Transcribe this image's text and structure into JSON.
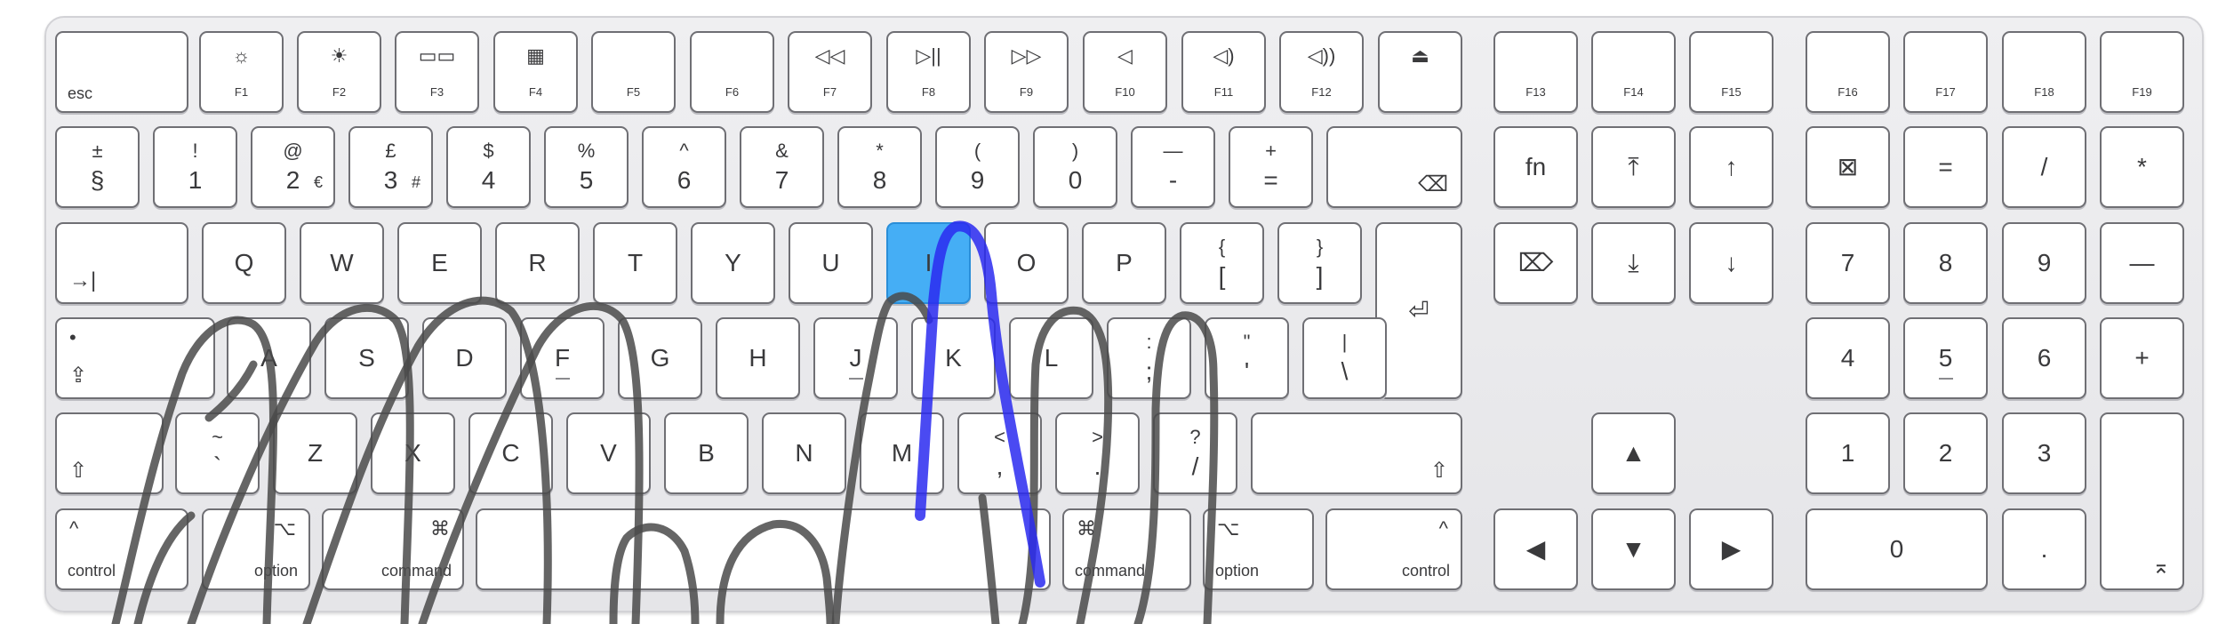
{
  "keyboard": {
    "rows": {
      "fn_row": [
        {
          "id": "esc",
          "bl": "esc"
        },
        {
          "id": "f1",
          "icon": "☼",
          "fn": "F1"
        },
        {
          "id": "f2",
          "icon": "☀",
          "fn": "F2"
        },
        {
          "id": "f3",
          "icon": "▭▭",
          "fn": "F3"
        },
        {
          "id": "f4",
          "icon": "▦",
          "fn": "F4"
        },
        {
          "id": "f5",
          "fn": "F5"
        },
        {
          "id": "f6",
          "fn": "F6"
        },
        {
          "id": "f7",
          "icon": "◁◁",
          "fn": "F7"
        },
        {
          "id": "f8",
          "icon": "▷||",
          "fn": "F8"
        },
        {
          "id": "f9",
          "icon": "▷▷",
          "fn": "F9"
        },
        {
          "id": "f10",
          "icon": "◁",
          "fn": "F10"
        },
        {
          "id": "f11",
          "icon": "◁)",
          "fn": "F11"
        },
        {
          "id": "f12",
          "icon": "◁))",
          "fn": "F12"
        },
        {
          "id": "eject",
          "icon": "⏏"
        },
        {
          "id": "f13",
          "fn": "F13"
        },
        {
          "id": "f14",
          "fn": "F14"
        },
        {
          "id": "f15",
          "fn": "F15"
        },
        {
          "id": "f16",
          "fn": "F16"
        },
        {
          "id": "f17",
          "fn": "F17"
        },
        {
          "id": "f18",
          "fn": "F18"
        },
        {
          "id": "f19",
          "fn": "F19"
        }
      ],
      "number_row": [
        {
          "id": "section",
          "top": "±",
          "bot": "§"
        },
        {
          "id": "1",
          "top": "!",
          "bot": "1"
        },
        {
          "id": "2",
          "top": "@",
          "bot": "2",
          "side": "€"
        },
        {
          "id": "3",
          "top": "£",
          "bot": "3",
          "side": "#"
        },
        {
          "id": "4",
          "top": "$",
          "bot": "4"
        },
        {
          "id": "5",
          "top": "%",
          "bot": "5"
        },
        {
          "id": "6",
          "top": "^",
          "bot": "6"
        },
        {
          "id": "7",
          "top": "&",
          "bot": "7"
        },
        {
          "id": "8",
          "top": "*",
          "bot": "8"
        },
        {
          "id": "9",
          "top": "(",
          "bot": "9"
        },
        {
          "id": "0",
          "top": ")",
          "bot": "0"
        },
        {
          "id": "minus",
          "top": "—",
          "bot": "-"
        },
        {
          "id": "equals",
          "top": "+",
          "bot": "="
        },
        {
          "id": "delete",
          "br": "⌫"
        },
        {
          "id": "fn",
          "main": "fn"
        },
        {
          "id": "home",
          "main": "⤒"
        },
        {
          "id": "pageup",
          "main": "↑"
        },
        {
          "id": "clear",
          "main": "⊠"
        },
        {
          "id": "kp-equals",
          "main": "="
        },
        {
          "id": "kp-divide",
          "main": "/"
        },
        {
          "id": "kp-multiply",
          "main": "*"
        }
      ],
      "qwerty_row": [
        {
          "id": "tab",
          "bl": "→|"
        },
        {
          "id": "q",
          "main": "Q"
        },
        {
          "id": "w",
          "main": "W"
        },
        {
          "id": "e",
          "main": "E"
        },
        {
          "id": "r",
          "main": "R"
        },
        {
          "id": "t",
          "main": "T"
        },
        {
          "id": "y",
          "main": "Y"
        },
        {
          "id": "u",
          "main": "U"
        },
        {
          "id": "i",
          "main": "I"
        },
        {
          "id": "o",
          "main": "O"
        },
        {
          "id": "p",
          "main": "P"
        },
        {
          "id": "lbracket",
          "top": "{",
          "bot": "["
        },
        {
          "id": "rbracket",
          "top": "}",
          "bot": "]"
        },
        {
          "id": "return",
          "main": "⏎"
        },
        {
          "id": "fwd-delete",
          "main": "⌦"
        },
        {
          "id": "end",
          "main": "⤓"
        },
        {
          "id": "pagedown",
          "main": "↓"
        },
        {
          "id": "kp-7",
          "main": "7"
        },
        {
          "id": "kp-8",
          "main": "8"
        },
        {
          "id": "kp-9",
          "main": "9"
        },
        {
          "id": "kp-minus",
          "main": "—"
        }
      ],
      "home_row": [
        {
          "id": "caps",
          "bl": "⇪",
          "dot": "•"
        },
        {
          "id": "a",
          "main": "A"
        },
        {
          "id": "s",
          "main": "S"
        },
        {
          "id": "d",
          "main": "D"
        },
        {
          "id": "f",
          "main": "F"
        },
        {
          "id": "g",
          "main": "G"
        },
        {
          "id": "h",
          "main": "H"
        },
        {
          "id": "j",
          "main": "J"
        },
        {
          "id": "k",
          "main": "K"
        },
        {
          "id": "l",
          "main": "L"
        },
        {
          "id": "semicolon",
          "top": ":",
          "bot": ";"
        },
        {
          "id": "quote",
          "top": "\"",
          "bot": "'"
        },
        {
          "id": "backslash",
          "top": "|",
          "bot": "\\"
        },
        {
          "id": "kp-4",
          "main": "4"
        },
        {
          "id": "kp-5",
          "main": "5"
        },
        {
          "id": "kp-6",
          "main": "6"
        },
        {
          "id": "kp-plus",
          "main": "+"
        }
      ],
      "shift_row": [
        {
          "id": "lshift",
          "bl": "⇧"
        },
        {
          "id": "grave",
          "top": "~",
          "bot": "`"
        },
        {
          "id": "z",
          "main": "Z"
        },
        {
          "id": "x",
          "main": "X"
        },
        {
          "id": "c",
          "main": "C"
        },
        {
          "id": "v",
          "main": "V"
        },
        {
          "id": "b",
          "main": "B"
        },
        {
          "id": "n",
          "main": "N"
        },
        {
          "id": "m",
          "main": "M"
        },
        {
          "id": "comma",
          "top": "<",
          "bot": ","
        },
        {
          "id": "period",
          "top": ">",
          "bot": "."
        },
        {
          "id": "slash",
          "top": "?",
          "bot": "/"
        },
        {
          "id": "rshift",
          "br": "⇧"
        },
        {
          "id": "up",
          "main": "▲"
        },
        {
          "id": "kp-1",
          "main": "1"
        },
        {
          "id": "kp-2",
          "main": "2"
        },
        {
          "id": "kp-3",
          "main": "3"
        },
        {
          "id": "kp-enter",
          "br": "⌅"
        }
      ],
      "bottom_row": [
        {
          "id": "lcontrol",
          "tl": "^",
          "bl": "control"
        },
        {
          "id": "loption",
          "tr": "⌥",
          "br": "option"
        },
        {
          "id": "lcommand",
          "tr": "⌘",
          "br": "command"
        },
        {
          "id": "space"
        },
        {
          "id": "rcommand",
          "tl": "⌘",
          "bl": "command"
        },
        {
          "id": "roption",
          "tl": "⌥",
          "bl": "option"
        },
        {
          "id": "rcontrol",
          "tr": "^",
          "br": "control"
        },
        {
          "id": "left",
          "main": "◀"
        },
        {
          "id": "down",
          "main": "▼"
        },
        {
          "id": "right",
          "main": "▶"
        },
        {
          "id": "kp-0",
          "main": "0"
        },
        {
          "id": "kp-decimal",
          "main": "."
        }
      ]
    },
    "highlighted_key": "i",
    "colors": {
      "highlight": "#45aef5",
      "stroke_gray": "#4a4a4a",
      "stroke_blue": "#2a2af0"
    }
  }
}
